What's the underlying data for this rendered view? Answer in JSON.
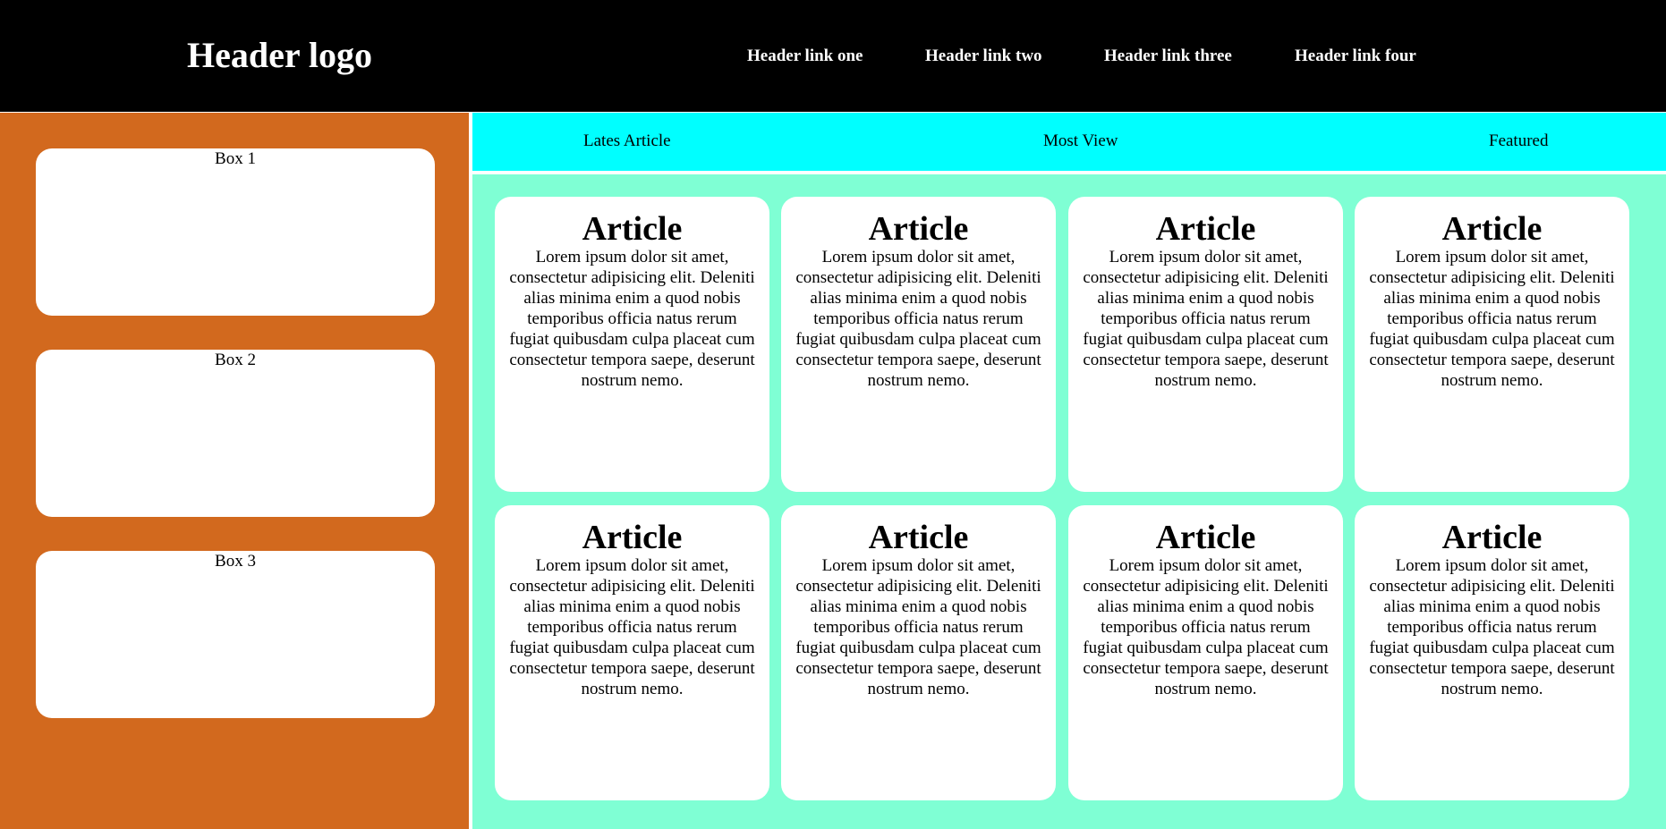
{
  "header": {
    "logo": "Header logo",
    "links": [
      {
        "label": "Header link one"
      },
      {
        "label": "Header link two"
      },
      {
        "label": "Header link three"
      },
      {
        "label": "Header link four"
      }
    ]
  },
  "sidebar": {
    "boxes": [
      {
        "label": "Box 1"
      },
      {
        "label": "Box 2"
      },
      {
        "label": "Box 3"
      }
    ]
  },
  "tabs": [
    {
      "label": "Lates Article"
    },
    {
      "label": "Most View"
    },
    {
      "label": "Featured"
    }
  ],
  "articles": [
    {
      "title": "Article",
      "body": "Lorem ipsum dolor sit amet, consectetur adipisicing elit. Deleniti alias minima enim a quod nobis temporibus officia natus rerum fugiat quibusdam culpa placeat cum consectetur tempora saepe, deserunt nostrum nemo."
    },
    {
      "title": "Article",
      "body": "Lorem ipsum dolor sit amet, consectetur adipisicing elit. Deleniti alias minima enim a quod nobis temporibus officia natus rerum fugiat quibusdam culpa placeat cum consectetur tempora saepe, deserunt nostrum nemo."
    },
    {
      "title": "Article",
      "body": "Lorem ipsum dolor sit amet, consectetur adipisicing elit. Deleniti alias minima enim a quod nobis temporibus officia natus rerum fugiat quibusdam culpa placeat cum consectetur tempora saepe, deserunt nostrum nemo."
    },
    {
      "title": "Article",
      "body": "Lorem ipsum dolor sit amet, consectetur adipisicing elit. Deleniti alias minima enim a quod nobis temporibus officia natus rerum fugiat quibusdam culpa placeat cum consectetur tempora saepe, deserunt nostrum nemo."
    },
    {
      "title": "Article",
      "body": "Lorem ipsum dolor sit amet, consectetur adipisicing elit. Deleniti alias minima enim a quod nobis temporibus officia natus rerum fugiat quibusdam culpa placeat cum consectetur tempora saepe, deserunt nostrum nemo."
    },
    {
      "title": "Article",
      "body": "Lorem ipsum dolor sit amet, consectetur adipisicing elit. Deleniti alias minima enim a quod nobis temporibus officia natus rerum fugiat quibusdam culpa placeat cum consectetur tempora saepe, deserunt nostrum nemo."
    },
    {
      "title": "Article",
      "body": "Lorem ipsum dolor sit amet, consectetur adipisicing elit. Deleniti alias minima enim a quod nobis temporibus officia natus rerum fugiat quibusdam culpa placeat cum consectetur tempora saepe, deserunt nostrum nemo."
    },
    {
      "title": "Article",
      "body": "Lorem ipsum dolor sit amet, consectetur adipisicing elit. Deleniti alias minima enim a quod nobis temporibus officia natus rerum fugiat quibusdam culpa placeat cum consectetur tempora saepe, deserunt nostrum nemo."
    }
  ],
  "colors": {
    "header_bg": "#000000",
    "sidebar_bg": "#d2691e",
    "tabs_bg": "#00ffff",
    "content_bg": "#7fffd4",
    "card_bg": "#ffffff"
  }
}
